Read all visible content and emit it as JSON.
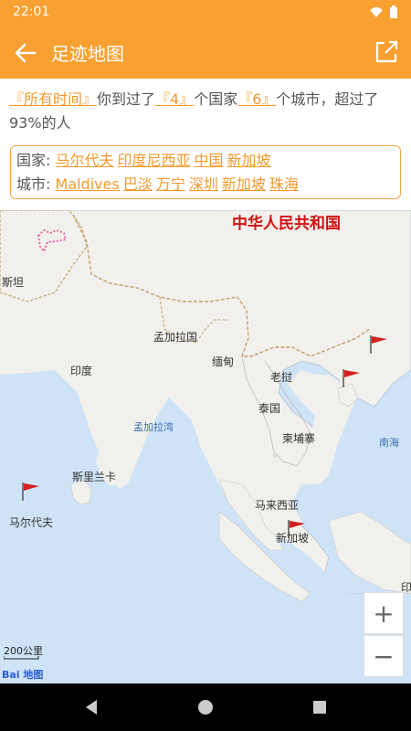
{
  "status": {
    "time": "22:01"
  },
  "header": {
    "title": "足迹地图"
  },
  "summary": {
    "period": "『所有时间』",
    "text1": "你到过了",
    "countries_count": "『4』",
    "text2": "个国家",
    "cities_count": "『6』",
    "text3": "个城市，超过了93%的人"
  },
  "countries": {
    "label": "国家:",
    "items": [
      "马尔代夫",
      "印度尼西亚",
      "中国",
      "新加坡"
    ]
  },
  "cities": {
    "label": "城市:",
    "items": [
      "Maldives",
      "巴淡",
      "万宁",
      "深圳",
      "新加坡",
      "珠海"
    ]
  },
  "map": {
    "labels": {
      "china": "中华人民共和国",
      "pakistan": "斯坦",
      "bangladesh": "孟加拉国",
      "india": "印度",
      "myanmar": "缅甸",
      "laos": "老挝",
      "thailand": "泰国",
      "cambodia": "柬埔寨",
      "bay": "孟加拉湾",
      "south_sea": "南海",
      "srilanka": "斯里兰卡",
      "maldives": "马尔代夫",
      "malaysia": "马来西亚",
      "singapore": "新加坡",
      "indonesia_partial": "印"
    },
    "scale": "200公里",
    "zoom_in": "+",
    "zoom_out": "−",
    "logo": "Bai 地图",
    "accent": "#f9a032",
    "flag_color": "#d32020"
  }
}
